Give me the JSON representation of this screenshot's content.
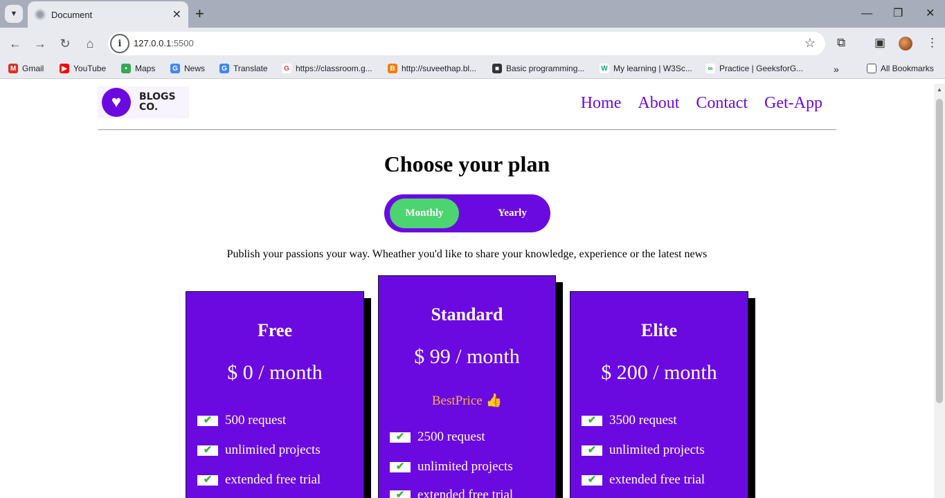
{
  "browser": {
    "tab_title": "Document",
    "url_host": "127.0.0.1",
    "url_port": ":5500",
    "bookmarks": [
      {
        "label": "Gmail",
        "icon": "gmail-icon",
        "color": "#d93025"
      },
      {
        "label": "YouTube",
        "icon": "youtube-icon",
        "color": "#ff0000"
      },
      {
        "label": "Maps",
        "icon": "maps-icon",
        "color": "#34a853"
      },
      {
        "label": "News",
        "icon": "news-icon",
        "color": "#4285f4"
      },
      {
        "label": "Translate",
        "icon": "translate-icon",
        "color": "#4285f4"
      },
      {
        "label": "https://classroom.g...",
        "icon": "google-icon",
        "color": "#ea4335"
      },
      {
        "label": "http://suveethap.bl...",
        "icon": "blogger-icon",
        "color": "#f57d00"
      },
      {
        "label": "Basic programming...",
        "icon": "site-icon",
        "color": "#333333"
      },
      {
        "label": "My learning | W3Sc...",
        "icon": "w3schools-icon",
        "color": "#04aa6d"
      },
      {
        "label": "Practice | GeeksforG...",
        "icon": "gfg-icon",
        "color": "#2f8d46"
      }
    ],
    "all_bookmarks": "All Bookmarks"
  },
  "page": {
    "logo_line1": "BLOGS",
    "logo_line2": "CO.",
    "nav": [
      "Home",
      "About",
      "Contact",
      "Get-App"
    ],
    "heading": "Choose your plan",
    "toggle_monthly": "Monthly",
    "toggle_yearly": "Yearly",
    "tagline": "Publish your passions your way. Wheather you'd like to share your knowledge, experience or the latest news",
    "accent": "#6b0ae0",
    "toggle_active_color": "#4cd470",
    "plans": [
      {
        "name": "Free",
        "price": "$ 0 / month",
        "features": [
          "500 request",
          "unlimited projects",
          "extended free trial"
        ]
      },
      {
        "name": "Standard",
        "price": "$ 99 / month",
        "badge": "BestPrice 👍",
        "features": [
          "2500 request",
          "unlimited projects",
          "extended free trial"
        ]
      },
      {
        "name": "Elite",
        "price": "$ 200 / month",
        "features": [
          "3500 request",
          "unlimited projects",
          "extended free trial"
        ]
      }
    ]
  }
}
